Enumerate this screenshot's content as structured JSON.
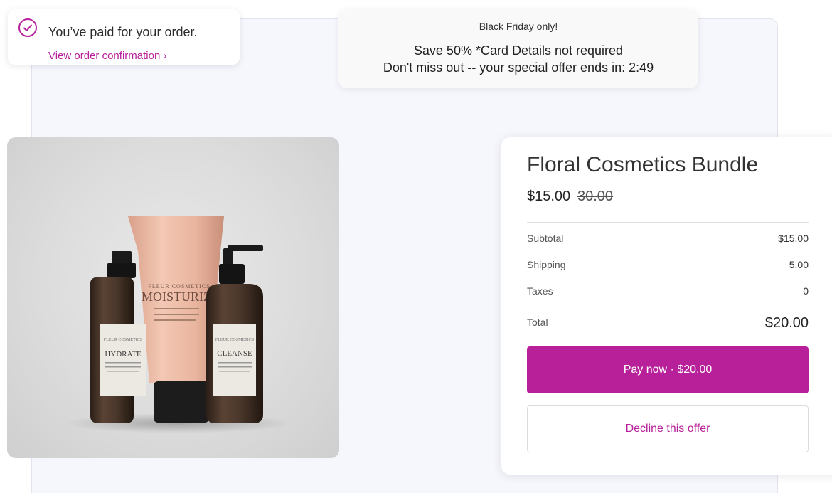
{
  "notice": {
    "title": "You’ve paid for your order.",
    "link": "View order confirmation ›",
    "icon": "check-circle-icon",
    "accent_color": "#b8209a"
  },
  "offer": {
    "heading": "Black Friday only!",
    "line1": "Save 50% *Card Details not required",
    "line2": "Don't miss out -- your special offer ends in: 2:49"
  },
  "product": {
    "title": "Floral Cosmetics Bundle",
    "price": "$15.00",
    "original_price": "30.00",
    "labels": {
      "tube": "MOISTURIZ",
      "left_bottle": "HYDRATE",
      "right_bottle": "CLEANSE"
    }
  },
  "summary": {
    "rows": [
      {
        "label": "Subtotal",
        "value": "$15.00"
      },
      {
        "label": "Shipping",
        "value": "5.00"
      },
      {
        "label": "Taxes",
        "value": "0"
      }
    ],
    "total_label": "Total",
    "total_value": "$20.00"
  },
  "actions": {
    "pay_label": "Pay now · $20.00",
    "decline_label": "Decline this offer"
  }
}
